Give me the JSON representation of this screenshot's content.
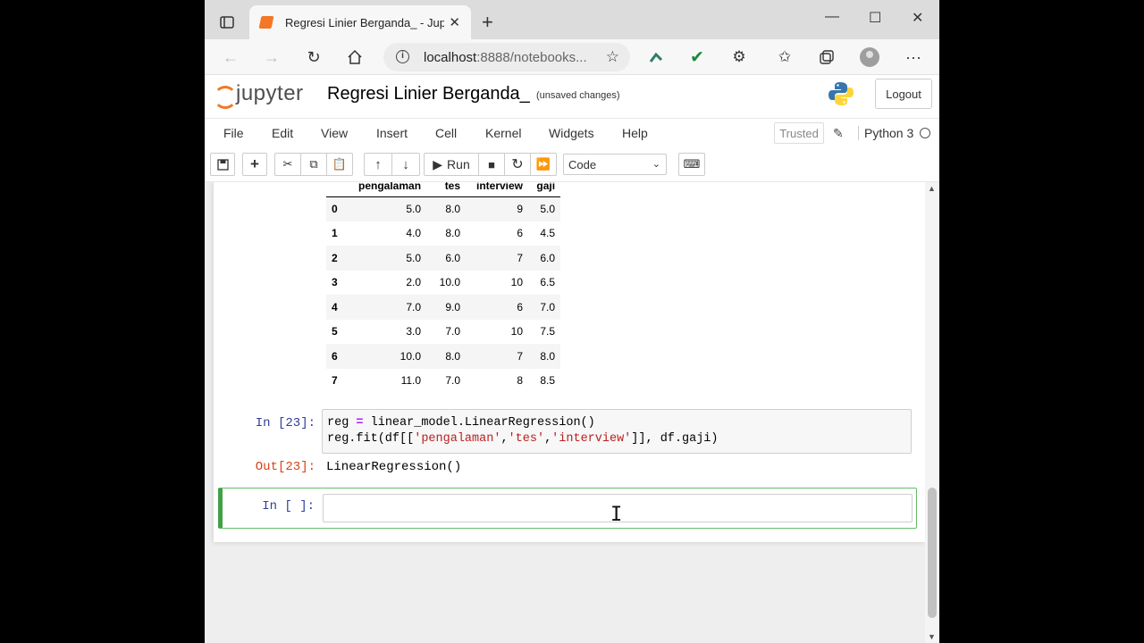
{
  "browser": {
    "tab_title": "Regresi Linier Berganda_ - Jupyter",
    "url_host": "localhost",
    "url_rest": ":8888/notebooks...",
    "new_tab_symbol": "+",
    "icons": [
      "tab-actions-icon",
      "back-icon",
      "forward-icon",
      "reload-icon",
      "home-icon",
      "info-icon",
      "add-favorite-icon",
      "extension-icon",
      "checkmark-icon",
      "puzzle-icon",
      "favorites-icon",
      "collections-icon",
      "profile-icon",
      "more-icon",
      "minimize-icon",
      "maximize-icon",
      "close-icon"
    ]
  },
  "jupyter": {
    "logo_text": "jupyter",
    "notebook_name": "Regresi Linier Berganda_",
    "save_status": "(unsaved changes)",
    "logout_label": "Logout",
    "menu": [
      "File",
      "Edit",
      "View",
      "Insert",
      "Cell",
      "Kernel",
      "Widgets",
      "Help"
    ],
    "trusted_label": "Trusted",
    "kernel_name": "Python 3",
    "toolbar": {
      "run_label": "Run",
      "cell_type": "Code"
    },
    "accent_color": "#f37726"
  },
  "dataframe": {
    "columns": [
      "pengalaman",
      "tes",
      "interview",
      "gaji"
    ],
    "rows": [
      [
        "0",
        "5.0",
        "8.0",
        "9",
        "5.0"
      ],
      [
        "1",
        "4.0",
        "8.0",
        "6",
        "4.5"
      ],
      [
        "2",
        "5.0",
        "6.0",
        "7",
        "6.0"
      ],
      [
        "3",
        "2.0",
        "10.0",
        "10",
        "6.5"
      ],
      [
        "4",
        "7.0",
        "9.0",
        "6",
        "7.0"
      ],
      [
        "5",
        "3.0",
        "7.0",
        "10",
        "7.5"
      ],
      [
        "6",
        "10.0",
        "8.0",
        "7",
        "8.0"
      ],
      [
        "7",
        "11.0",
        "7.0",
        "8",
        "8.5"
      ]
    ]
  },
  "cells": {
    "cell23": {
      "in_prompt": "In [23]:",
      "out_prompt": "Out[23]:",
      "output": "LinearRegression()"
    },
    "empty": {
      "in_prompt": "In [ ]:"
    }
  }
}
